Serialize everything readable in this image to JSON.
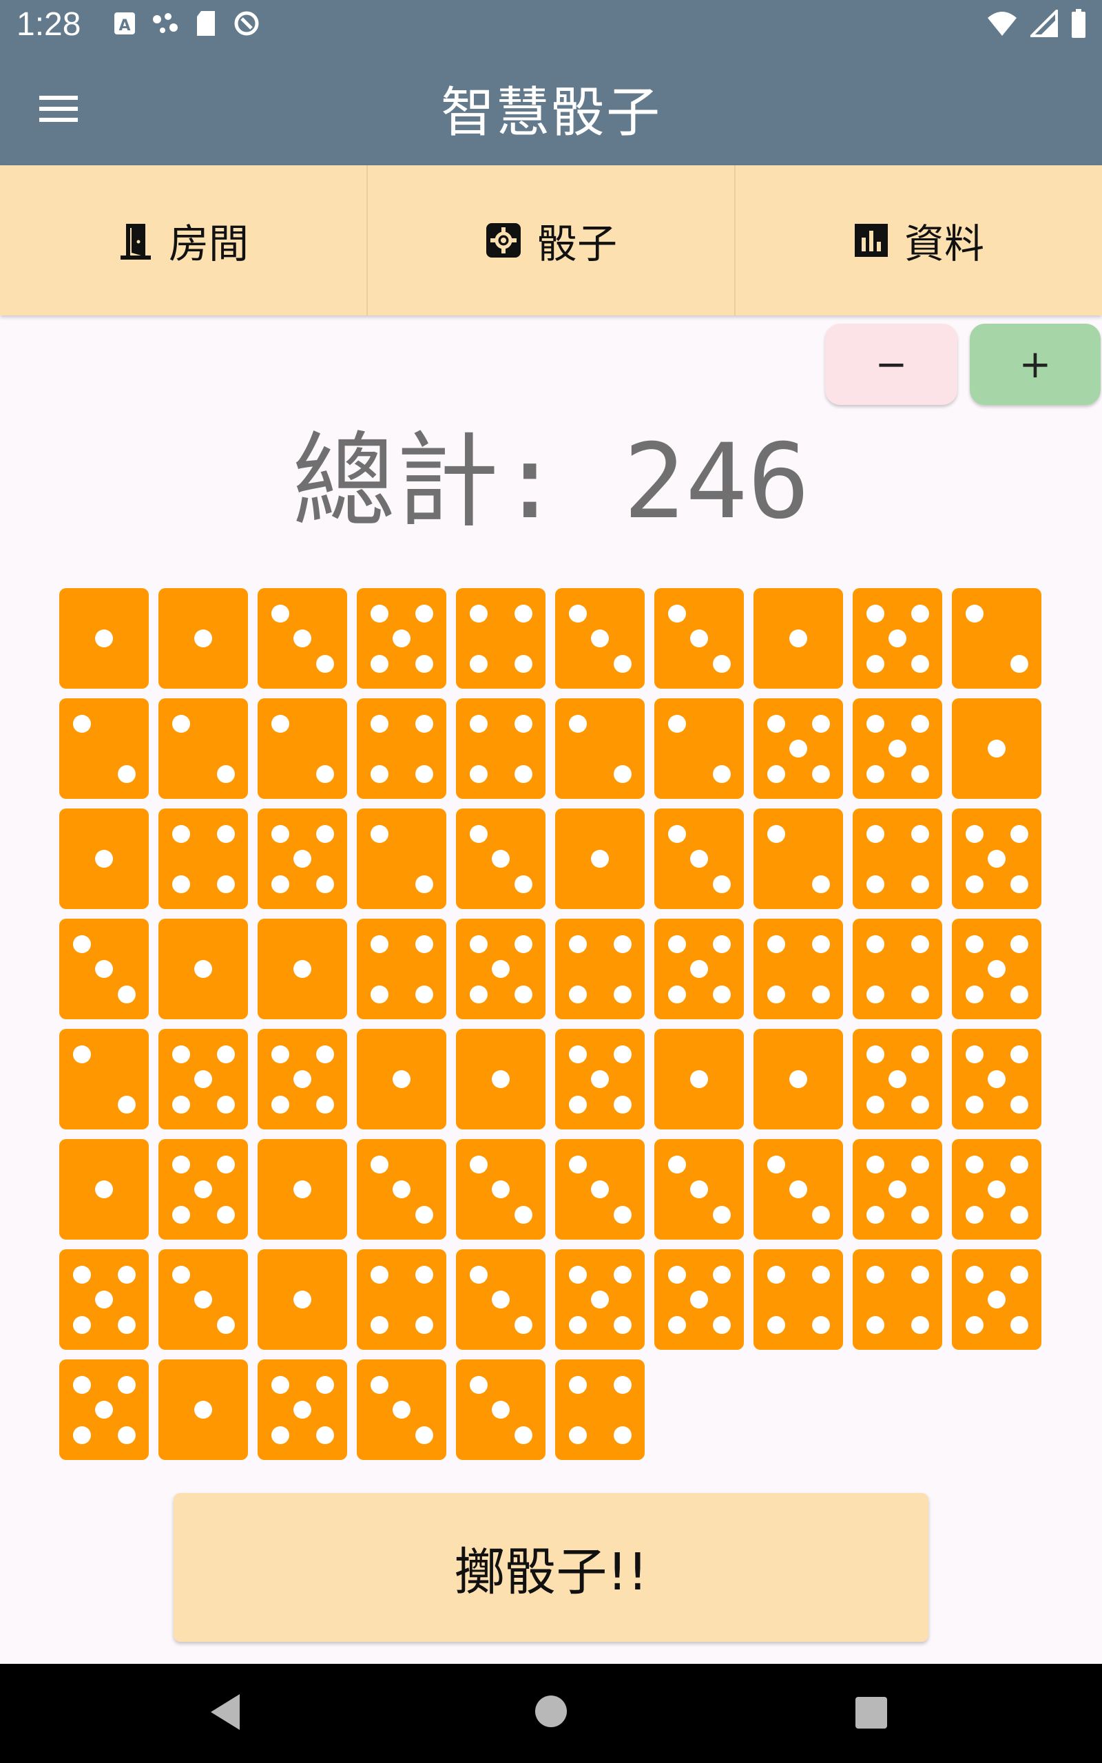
{
  "status_bar": {
    "time": "1:28",
    "left_icons": [
      "keyboard-a-icon",
      "assistant-dots-icon",
      "sd-card-icon",
      "sync-icon"
    ],
    "right_icons": [
      "wifi-icon",
      "cell-signal-icon",
      "battery-icon"
    ]
  },
  "app_bar": {
    "title": "智慧骰子",
    "menu_icon": "hamburger-menu-icon"
  },
  "tabs": [
    {
      "label": "房間",
      "icon": "door-icon"
    },
    {
      "label": "骰子",
      "icon": "dice-icon"
    },
    {
      "label": "資料",
      "icon": "bar-chart-icon"
    }
  ],
  "controls": {
    "minus_label": "−",
    "plus_label": "+"
  },
  "total": {
    "label": "總計:",
    "value": "246"
  },
  "dice": [
    1,
    1,
    3,
    5,
    4,
    3,
    3,
    1,
    5,
    2,
    2,
    2,
    2,
    4,
    4,
    2,
    2,
    5,
    5,
    1,
    1,
    4,
    5,
    2,
    3,
    1,
    3,
    2,
    4,
    5,
    3,
    1,
    1,
    4,
    5,
    4,
    5,
    4,
    4,
    5,
    2,
    5,
    5,
    1,
    1,
    5,
    1,
    1,
    5,
    5,
    1,
    5,
    1,
    3,
    3,
    3,
    3,
    3,
    5,
    5,
    5,
    3,
    1,
    4,
    3,
    5,
    5,
    4,
    4,
    5,
    5,
    1,
    5,
    3,
    3,
    4
  ],
  "roll_button": {
    "label": "擲骰子!!"
  },
  "colors": {
    "app_bar": "#637a8d",
    "tab_bar": "#fde0b0",
    "die": "#ff9700",
    "pip": "#ffffff",
    "minus_button": "#fbe3e8",
    "plus_button": "#a6d6a8",
    "total_text": "#707070",
    "roll_button": "#fde0b0"
  }
}
